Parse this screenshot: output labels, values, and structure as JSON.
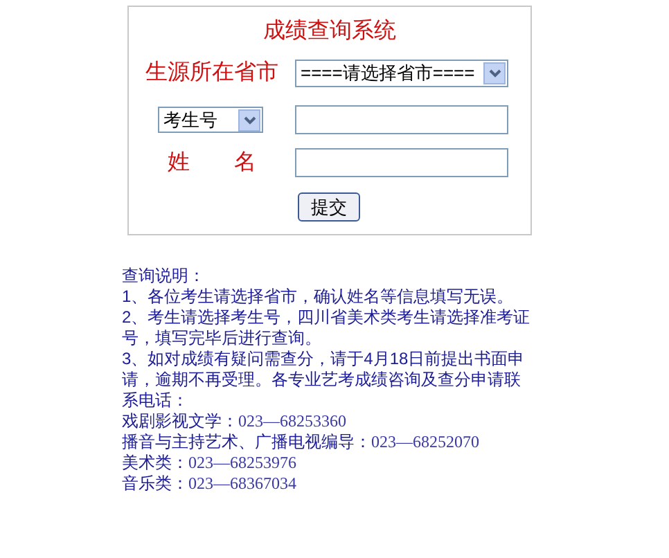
{
  "form": {
    "title": "成绩查询系统",
    "province": {
      "label": "生源所在省市",
      "value": "====请选择省市===="
    },
    "id_field": {
      "type_value": "考生号"
    },
    "name_field": {
      "label": "姓　　名"
    },
    "submit": "提交"
  },
  "notes": {
    "heading": "查询说明：",
    "paragraphs": [
      "1、各位考生请选择省市，确认姓名等信息填写无误。",
      "2、考生请选择考生号，四川省美术类考生请选择准考证号，填写完毕后进行查询。",
      "3、如对成绩有疑问需查分，请于4月18日前提出书面申请，逾期不再受理。各专业艺考成绩咨询及查分申请联系电话："
    ],
    "contacts": [
      {
        "label": "戏剧影视文学：",
        "phone": "023—68253360"
      },
      {
        "label": "播音与主持艺术、广播电视编导：",
        "phone": "023—68252070"
      },
      {
        "label": "美术类：",
        "phone": "023—68253976"
      },
      {
        "label": "音乐类：",
        "phone": "023—68367034"
      }
    ]
  }
}
